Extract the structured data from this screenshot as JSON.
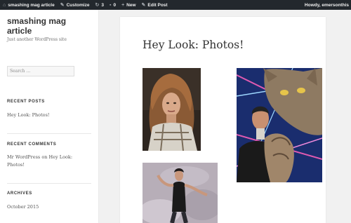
{
  "adminbar": {
    "site_name": "smashing mag article",
    "customize": "Customize",
    "updates_count": "3",
    "comments_count": "0",
    "new": "New",
    "edit_post": "Edit Post",
    "howdy": "Howdy, emersonthis"
  },
  "sidebar": {
    "site_title": "smashing mag article",
    "site_description": "Just another WordPress site",
    "search_placeholder": "Search …",
    "recent_posts_title": "RECENT POSTS",
    "recent_posts": [
      "Hey Look: Photos!"
    ],
    "recent_comments_title": "RECENT COMMENTS",
    "recent_comment": {
      "author": "Mr WordPress",
      "on": "on",
      "post": "Hey Look: Photos!"
    },
    "archives_title": "ARCHIVES",
    "archives": [
      "October 2015"
    ]
  },
  "main": {
    "entry_title": "Hey Look: Photos!"
  },
  "colors": {
    "adminbar_bg": "#23282d",
    "page_bg": "#f1f1f1",
    "panel_bg": "#ffffff"
  }
}
